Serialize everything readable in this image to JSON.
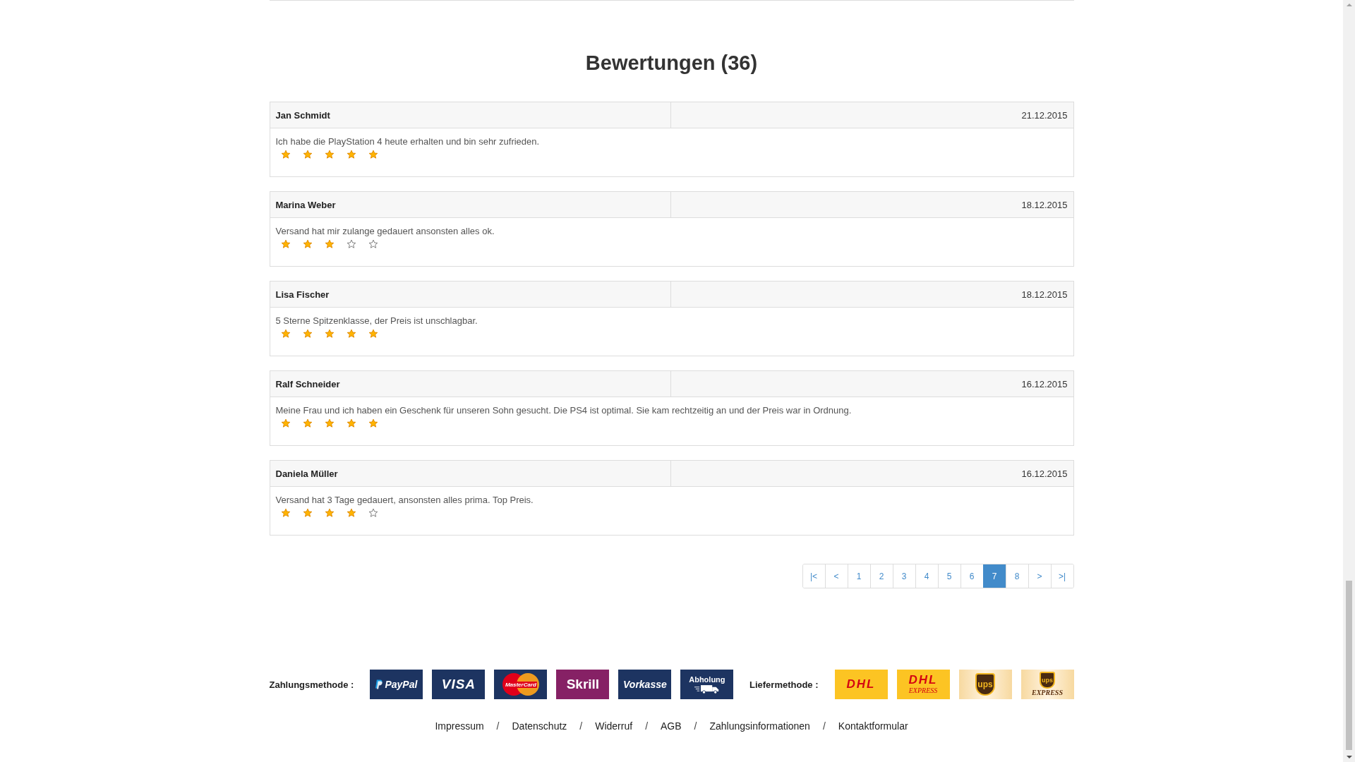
{
  "heading": "Bewertungen (36)",
  "reviews": [
    {
      "name": "Jan Schmidt",
      "date": "21.12.2015",
      "text": "Ich habe die PlayStation 4 heute erhalten und bin sehr zufrieden.",
      "stars": 5
    },
    {
      "name": "Marina Weber",
      "date": "18.12.2015",
      "text": "Versand hat mir zulange gedauert ansonsten alles ok.",
      "stars": 3
    },
    {
      "name": "Lisa Fischer",
      "date": "18.12.2015",
      "text": "5 Sterne Spitzenklasse, der Preis ist unschlagbar.",
      "stars": 5
    },
    {
      "name": "Ralf Schneider",
      "date": "16.12.2015",
      "text": "Meine Frau und ich haben ein Geschenk für unseren Sohn gesucht. Die PS4 ist optimal. Sie kam rechtzeitig an und der Preis war in Ordnung.",
      "stars": 5
    },
    {
      "name": "Daniela Müller",
      "date": "16.12.2015",
      "text": "Versand hat 3 Tage gedauert, ansonsten alles prima. Top Preis.",
      "stars": 4
    }
  ],
  "pagination": [
    {
      "label": "|<",
      "selected": false
    },
    {
      "label": "<",
      "selected": false
    },
    {
      "label": "1",
      "selected": false
    },
    {
      "label": "2",
      "selected": false
    },
    {
      "label": "3",
      "selected": false
    },
    {
      "label": "4",
      "selected": false
    },
    {
      "label": "5",
      "selected": false
    },
    {
      "label": "6",
      "selected": false
    },
    {
      "label": "7",
      "selected": true
    },
    {
      "label": "8",
      "selected": false
    },
    {
      "label": ">",
      "selected": false
    },
    {
      "label": ">|",
      "selected": false
    }
  ],
  "payment": {
    "label": "Zahlungsmethode :",
    "methods": [
      {
        "kind": "paypal",
        "text": "PayPal"
      },
      {
        "kind": "visa",
        "text": "VISA"
      },
      {
        "kind": "mastercard",
        "text": "MasterCard"
      },
      {
        "kind": "skrill",
        "text": "Skrill"
      },
      {
        "kind": "vorkasse",
        "text": "Vorkasse"
      },
      {
        "kind": "abholung",
        "text": "Abholung"
      }
    ]
  },
  "shipping": {
    "label": "Liefermethode :",
    "methods": [
      {
        "kind": "dhl",
        "text": "DHL"
      },
      {
        "kind": "dhl-express",
        "text": "DHL",
        "subtext": "EXPRESS"
      },
      {
        "kind": "ups",
        "text": "ups"
      },
      {
        "kind": "ups-express",
        "text": "ups",
        "subtext": "EXPRESS"
      }
    ]
  },
  "footer_links": {
    "separator": "/",
    "items": [
      "Impressum",
      "Datenschutz",
      "Widerruf",
      "AGB",
      "Zahlungsinformationen",
      "Kontaktformular"
    ]
  }
}
